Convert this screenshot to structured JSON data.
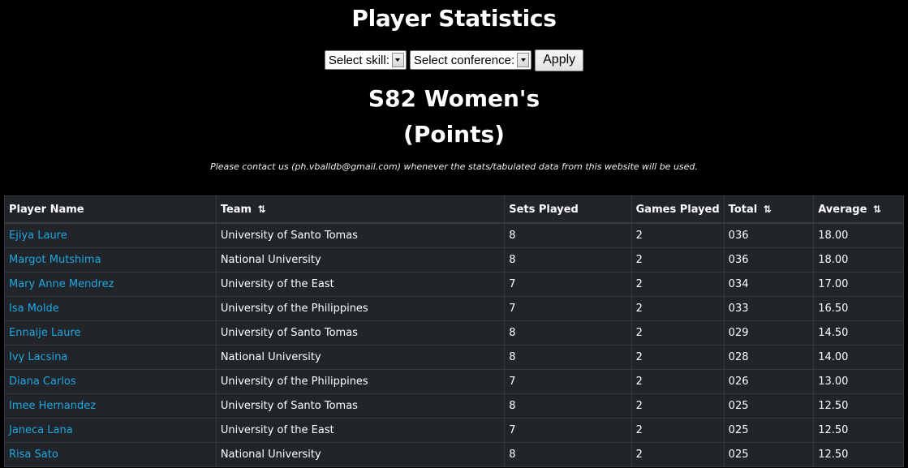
{
  "page": {
    "title": "Player Statistics",
    "subtitle_line1": "S82 Women's",
    "subtitle_line2": "(Points)",
    "notice": "Please contact us (ph.vballdb@gmail.com) whenever the stats/tabulated data from this website will be used."
  },
  "filters": {
    "skill_select": "Select skill:",
    "conference_select": "Select conference:",
    "apply_label": "Apply"
  },
  "colors": {
    "background": "#000000",
    "table_bg": "#212529",
    "border": "#32383e",
    "link": "#1ea7e1",
    "text": "#ffffff"
  },
  "table": {
    "columns": [
      {
        "label": "Player Name",
        "sortable": false
      },
      {
        "label": "Team",
        "sortable": true
      },
      {
        "label": "Sets Played",
        "sortable": false
      },
      {
        "label": "Games Played",
        "sortable": false
      },
      {
        "label": "Total",
        "sortable": true
      },
      {
        "label": "Average",
        "sortable": true
      }
    ],
    "sort_icon": "⇅",
    "rows": [
      {
        "name": "Ejiya Laure",
        "team": "University of Santo Tomas",
        "sets": "8",
        "games": "2",
        "total": "036",
        "average": "18.00"
      },
      {
        "name": "Margot Mutshima",
        "team": "National University",
        "sets": "8",
        "games": "2",
        "total": "036",
        "average": "18.00"
      },
      {
        "name": "Mary Anne Mendrez",
        "team": "University of the East",
        "sets": "7",
        "games": "2",
        "total": "034",
        "average": "17.00"
      },
      {
        "name": "Isa Molde",
        "team": "University of the Philippines",
        "sets": "7",
        "games": "2",
        "total": "033",
        "average": "16.50"
      },
      {
        "name": "Ennaije Laure",
        "team": "University of Santo Tomas",
        "sets": "8",
        "games": "2",
        "total": "029",
        "average": "14.50"
      },
      {
        "name": "Ivy Lacsina",
        "team": "National University",
        "sets": "8",
        "games": "2",
        "total": "028",
        "average": "14.00"
      },
      {
        "name": "Diana Carlos",
        "team": "University of the Philippines",
        "sets": "7",
        "games": "2",
        "total": "026",
        "average": "13.00"
      },
      {
        "name": "Imee Hernandez",
        "team": "University of Santo Tomas",
        "sets": "8",
        "games": "2",
        "total": "025",
        "average": "12.50"
      },
      {
        "name": "Janeca Lana",
        "team": "University of the East",
        "sets": "7",
        "games": "2",
        "total": "025",
        "average": "12.50"
      },
      {
        "name": "Risa Sato",
        "team": "National University",
        "sets": "8",
        "games": "2",
        "total": "025",
        "average": "12.50"
      }
    ]
  }
}
